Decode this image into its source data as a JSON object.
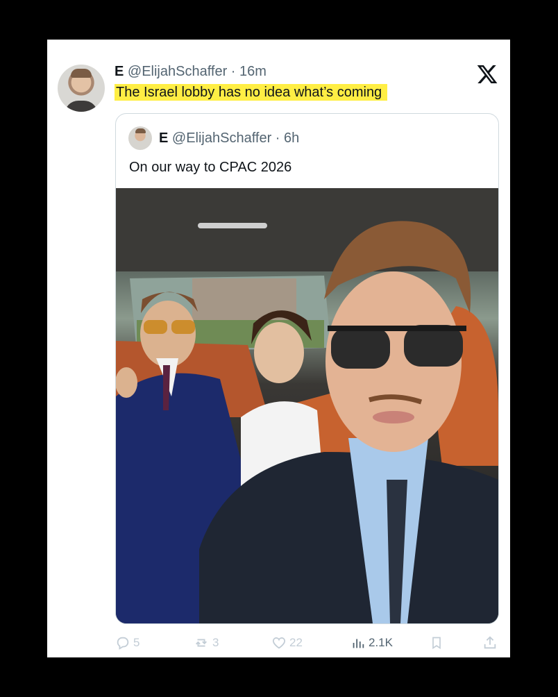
{
  "tweet": {
    "display_name": "E",
    "handle": "@ElijahSchaffer",
    "time": "16m",
    "text": "The Israel lobby has no idea what’s coming",
    "highlight_color": "#ffee44"
  },
  "quoted_tweet": {
    "display_name": "E",
    "handle": "@ElijahSchaffer",
    "time": "6h",
    "text": "On our way to CPAC 2026"
  },
  "actions": {
    "replies": "5",
    "reposts": "3",
    "likes": "22",
    "views": "2.1K"
  },
  "icons": [
    "x-logo-icon",
    "reply-icon",
    "repost-icon",
    "like-icon",
    "views-icon",
    "bookmark-icon",
    "share-icon"
  ],
  "colors": {
    "text": "#0f1419",
    "muted": "#536471",
    "border": "#cfd9de",
    "background": "#000000"
  }
}
